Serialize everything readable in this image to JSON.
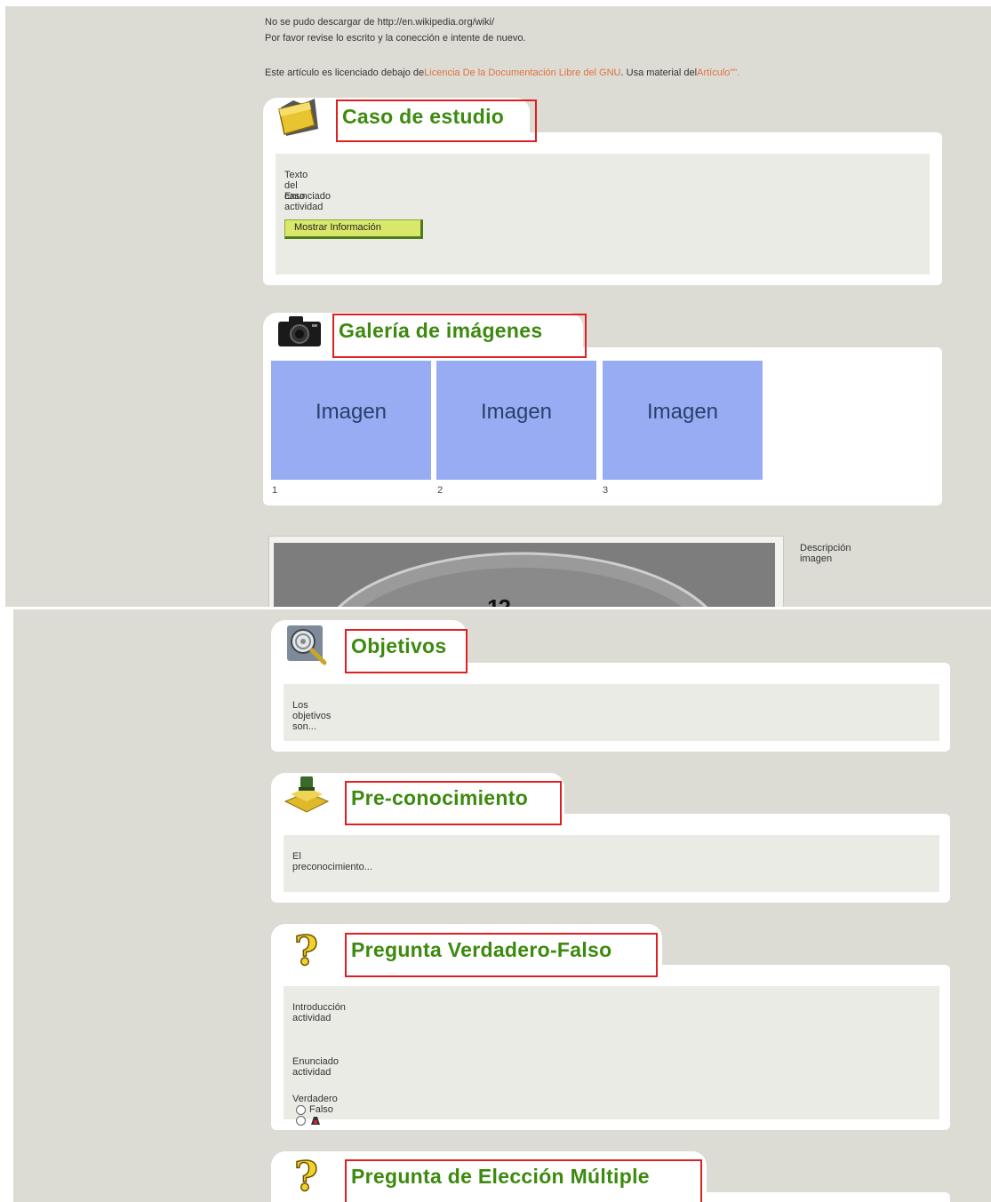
{
  "messages": {
    "error_line1": "No se pudo descargar de http://en.wikipedia.org/wiki/",
    "error_line2": "Por favor revise lo escrito y la conección e intente de nuevo.",
    "license_prefix": "Este artículo es licenciado debajo de",
    "license_link": "Licencia De la Documentación Libre del GNU",
    "license_middle": ". Usa material del",
    "article_link": "Artículo\"\"."
  },
  "case_study": {
    "title": "Caso de estudio",
    "text1": "Texto del caso",
    "text2": "Enunciado actividad",
    "button": "Mostrar Información",
    "icon": "folder-icon"
  },
  "gallery": {
    "title": "Galería de imágenes",
    "icon": "camera-icon",
    "images": [
      {
        "label": "Imagen",
        "num": "1"
      },
      {
        "label": "Imagen",
        "num": "2"
      },
      {
        "label": "Imagen",
        "num": "3"
      }
    ],
    "description": "Descripción imagen"
  },
  "objectives": {
    "title": "Objetivos",
    "icon": "magnifier-target-icon",
    "text": "Los objetivos son..."
  },
  "preknowledge": {
    "title": "Pre-conocimiento",
    "icon": "preknowledge-icon",
    "text": "El preconocimiento..."
  },
  "true_false": {
    "title": "Pregunta Verdadero-Falso",
    "icon": "question-mark-icon",
    "intro": "Introducción actividad",
    "statement": "Enunciado actividad",
    "true_label": "Verdadero",
    "false_label": "Falso"
  },
  "multiple_choice": {
    "title": "Pregunta de Elección Múltiple",
    "icon": "question-mark-icon"
  },
  "colors": {
    "background": "#dcdcd4",
    "title_green": "#3c8a0e",
    "title_border": "#e02020",
    "image_placeholder": "#97acf3",
    "link": "#e07040"
  }
}
